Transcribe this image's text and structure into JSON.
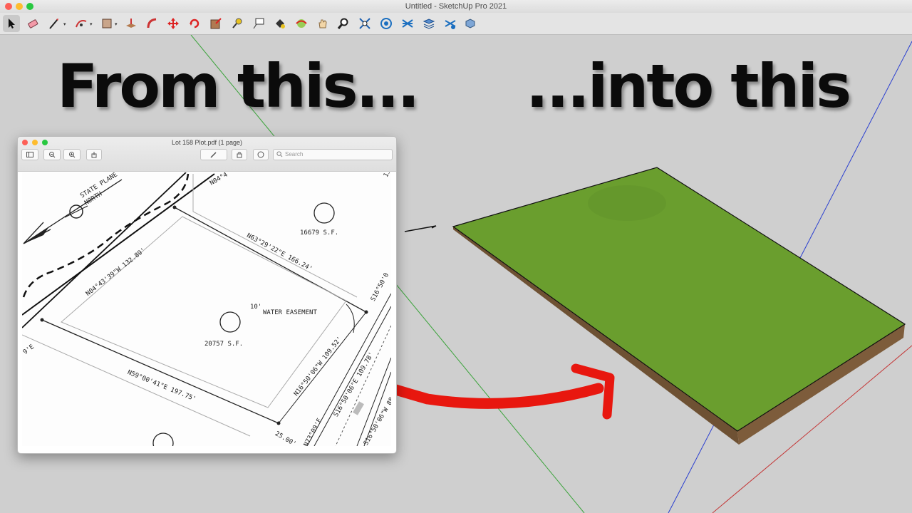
{
  "window": {
    "title": "Untitled - SketchUp Pro 2021"
  },
  "toolbar": {
    "tools": [
      "select-tool",
      "eraser-tool",
      "line-tool",
      "arc-tool",
      "rectangle-tool",
      "push-pull-tool",
      "follow-me-tool",
      "move-tool",
      "rotate-tool",
      "scale-tool",
      "tape-measure-tool",
      "text-tool",
      "paint-bucket-tool",
      "orbit-tool",
      "pan-tool",
      "zoom-tool",
      "zoom-extents-tool",
      "3d-warehouse-tool",
      "sandbox-tool",
      "layers-tool",
      "component-tool",
      "extension-tool"
    ],
    "selected": "select-tool"
  },
  "headlines": {
    "left": "From this...",
    "right": "...into this"
  },
  "preview": {
    "title": "Lot 158 Plot.pdf (1 page)",
    "search_placeholder": "Search",
    "plot_labels": {
      "north": "STATE PLANE",
      "north2": "NORTH",
      "area1": "16679 S.F.",
      "area2": "20757 S.F.",
      "easement_width": "10'",
      "easement": "WATER EASEMENT",
      "bearing1": "N63°29'22\"E 166.24'",
      "bearing2": "N04°43'39\"W 132.89'",
      "bearing3": "N59°00'41\"E 197.75'",
      "bearing4": "N16°50'06\"W 109.52'",
      "bearing5": "S16°50'06\"E 109.78'",
      "bearing6": "S16°50'06\"W 88",
      "bearing7": "N73°09'E",
      "bearing8": "25.00'",
      "bearing9": "N04°4",
      "bearing10": "S16°50'0",
      "bearing11": "13",
      "bearing12": "9'E"
    }
  },
  "colors": {
    "terrain_top": "#6a9e2e",
    "terrain_side": "#7a5b38",
    "axis_green": "#3aa33a",
    "axis_blue": "#2a3fd0",
    "axis_red": "#c43434",
    "arrow": "#e8170f"
  }
}
